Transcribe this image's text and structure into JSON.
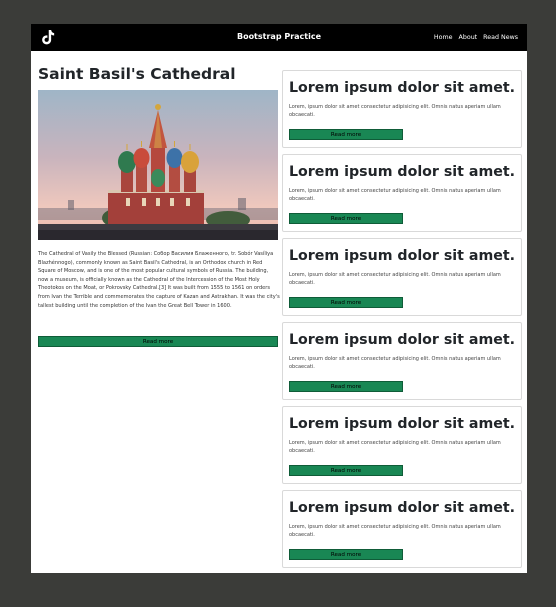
{
  "navbar": {
    "logo_icon": "tiktok-logo-icon",
    "brand": "Bootstrap Practice",
    "links": [
      "Home",
      "About",
      "Read News"
    ]
  },
  "main": {
    "title": "Saint Basil's Cathedral",
    "image_icon": "cathedral-photo",
    "text": "The Cathedral of Vasily the Blessed (Russian: Собор Василия Блаженного, tr. Sobór Vasíliya Blazhénnogo), commonly known as Saint Basil's Cathedral, is an Orthodox church in Red Square of Moscow, and is one of the most popular cultural symbols of Russia. The building, now a museum, is officially known as the Cathedral of the Intercession of the Most Holy Theotokos on the Moat, or Pokrovsky Cathedral.[3] It was built from 1555 to 1561 on orders from Ivan the Terrible and commemorates the capture of Kazan and Astrakhan. It was the city's tallest building until the completion of the Ivan the Great Bell Tower in 1600.",
    "button": "Read more"
  },
  "cards": [
    {
      "title": "Lorem ipsum dolor sit amet.",
      "text": "Lorem, ipsum dolor sit amet consectetur adipisicing elit. Omnis natus aperiam ullam obcaecati.",
      "button": "Read more"
    },
    {
      "title": "Lorem ipsum dolor sit amet.",
      "text": "Lorem, ipsum dolor sit amet consectetur adipisicing elit. Omnis natus aperiam ullam obcaecati.",
      "button": "Read more"
    },
    {
      "title": "Lorem ipsum dolor sit amet.",
      "text": "Lorem, ipsum dolor sit amet consectetur adipisicing elit. Omnis natus aperiam ullam obcaecati.",
      "button": "Read more"
    },
    {
      "title": "Lorem ipsum dolor sit amet.",
      "text": "Lorem, ipsum dolor sit amet consectetur adipisicing elit. Omnis natus aperiam ullam obcaecati.",
      "button": "Read more"
    },
    {
      "title": "Lorem ipsum dolor sit amet.",
      "text": "Lorem, ipsum dolor sit amet consectetur adipisicing elit. Omnis natus aperiam ullam obcaecati.",
      "button": "Read more"
    },
    {
      "title": "Lorem ipsum dolor sit amet.",
      "text": "Lorem, ipsum dolor sit amet consectetur adipisicing elit. Omnis natus aperiam ullam obcaecati.",
      "button": "Read more"
    }
  ],
  "colors": {
    "button_green": "#198754",
    "navbar_bg": "#000000",
    "backdrop": "#3b3c39"
  }
}
